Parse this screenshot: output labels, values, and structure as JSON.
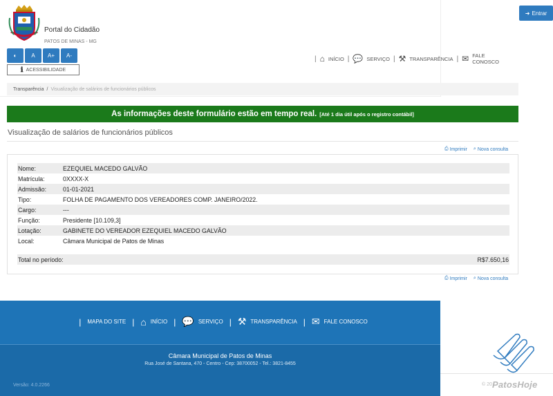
{
  "header": {
    "portal_title": "Portal do Cidadão",
    "portal_subtitle": "PATOS DE MINAS - MG",
    "accessibility_buttons": [
      "◐",
      "A",
      "A+",
      "A-"
    ],
    "accessibility_label": "ACESSIBILIDADE",
    "login_label": "Entrar",
    "nav": [
      {
        "label": "INÍCIO",
        "icon": "home-icon"
      },
      {
        "label": "SERVIÇO",
        "icon": "comments-icon"
      },
      {
        "label": "TRANSPARÊNCIA",
        "icon": "gavel-icon"
      },
      {
        "label": "FALE CONOSCO",
        "icon": "envelope-icon"
      }
    ]
  },
  "breadcrumb": {
    "root": "Transparência",
    "separator": "/",
    "current": "Visualização de salários de funcionários públicos"
  },
  "banner": {
    "main": "As informações deste formulário estão em tempo real.",
    "note": "[Até 1 dia útil após o registro contábil]",
    "color": "#1b7a1b"
  },
  "page_title": "Visualização de salários de funcionários públicos",
  "actions": {
    "print_label": "Imprimir",
    "new_query_label": "Nova consulta"
  },
  "record": {
    "rows": [
      {
        "label": "Nome:",
        "value": "EZEQUIEL MACEDO GALVÃO"
      },
      {
        "label": "Matrícula:",
        "value": "0XXXX-X"
      },
      {
        "label": "Admissão:",
        "value": "01-01-2021"
      },
      {
        "label": "Tipo:",
        "value": "FOLHA DE PAGAMENTO DOS VEREADORES COMP. JANEIRO/2022."
      },
      {
        "label": "Cargo:",
        "value": "---"
      },
      {
        "label": "Função:",
        "value": "Presidente [10.109,3]"
      },
      {
        "label": "Lotação:",
        "value": "GABINETE DO VEREADOR EZEQUIEL MACEDO GALVÃO"
      },
      {
        "label": "Local:",
        "value": "Câmara Municipal de Patos de Minas"
      }
    ],
    "total_label": "Total no período:",
    "total_value": "R$7.650,16"
  },
  "footer": {
    "nav": [
      {
        "label": "MAPA DO SITE",
        "icon": ""
      },
      {
        "label": "INÍCIO",
        "icon": "home-icon"
      },
      {
        "label": "SERVIÇO",
        "icon": "comments-icon"
      },
      {
        "label": "TRANSPARÊNCIA",
        "icon": "gavel-icon"
      },
      {
        "label": "FALE CONOSCO",
        "icon": "envelope-icon"
      }
    ],
    "org_name": "Câmara Municipal de Patos de Minas",
    "address": "Rua José de Santana, 470 - Centro - Cep: 38700052 - Tel.: 3821-8455",
    "version": "Versão: 4.0.2266",
    "copyright": "© 20",
    "watermark": "PatosHoje"
  },
  "colors": {
    "primary": "#2f7bbf",
    "footer": "#1e74b7",
    "banner": "#1b7a1b"
  }
}
